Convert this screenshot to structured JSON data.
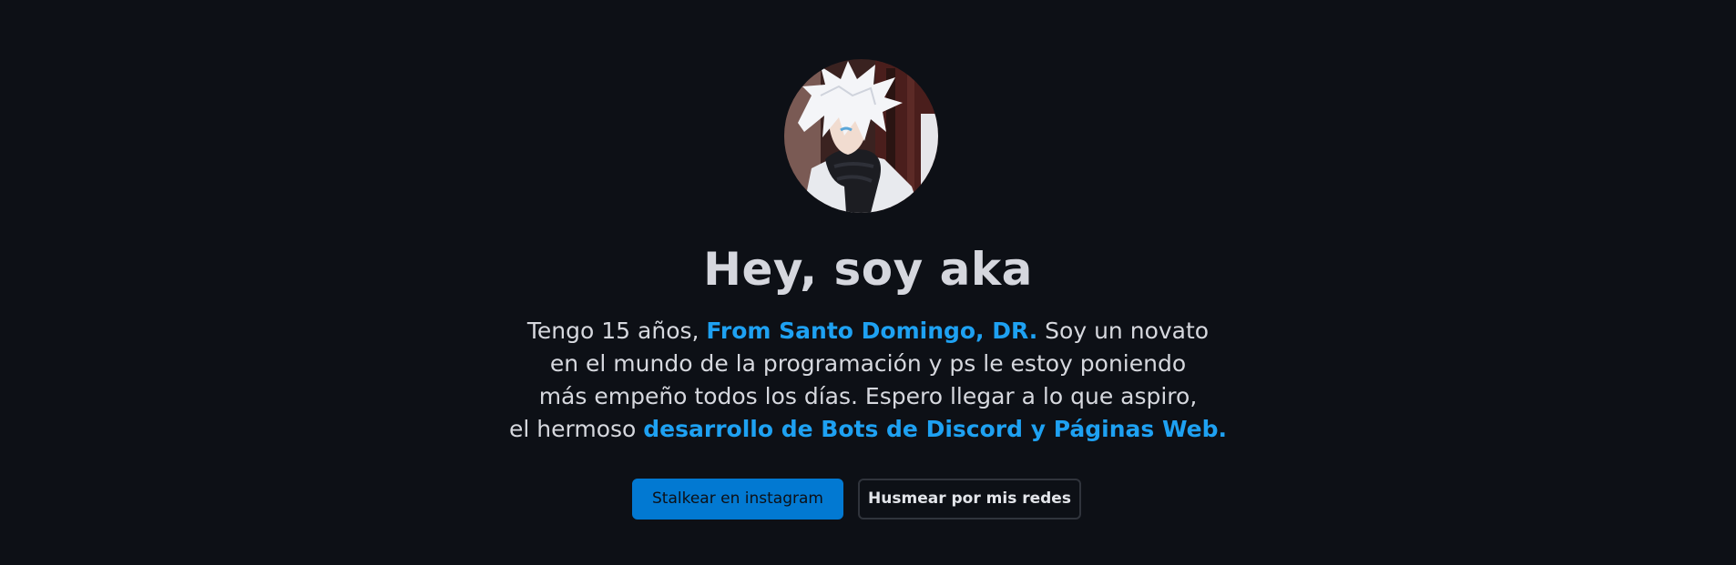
{
  "hero": {
    "avatar_alt": "avatar",
    "title": "Hey, soy aka",
    "bio": {
      "line1_pre": "Tengo 15 años, ",
      "line1_hl": "From Santo Domingo, DR.",
      "line1_post": " Soy un novato",
      "line2": "en el mundo de la programación y ps le estoy poniendo",
      "line3": "más empeño todos los días. Espero llegar a lo que aspiro,",
      "line4_pre": "el hermoso ",
      "line4_hl": "desarrollo de Bots de Discord y Páginas Web."
    },
    "buttons": {
      "primary_label": "Stalkear en instagram",
      "secondary_label": "Husmear por mis redes"
    }
  },
  "colors": {
    "background": "#0d1016",
    "accent": "#1ea1f2",
    "primary_button": "#0279d2"
  }
}
